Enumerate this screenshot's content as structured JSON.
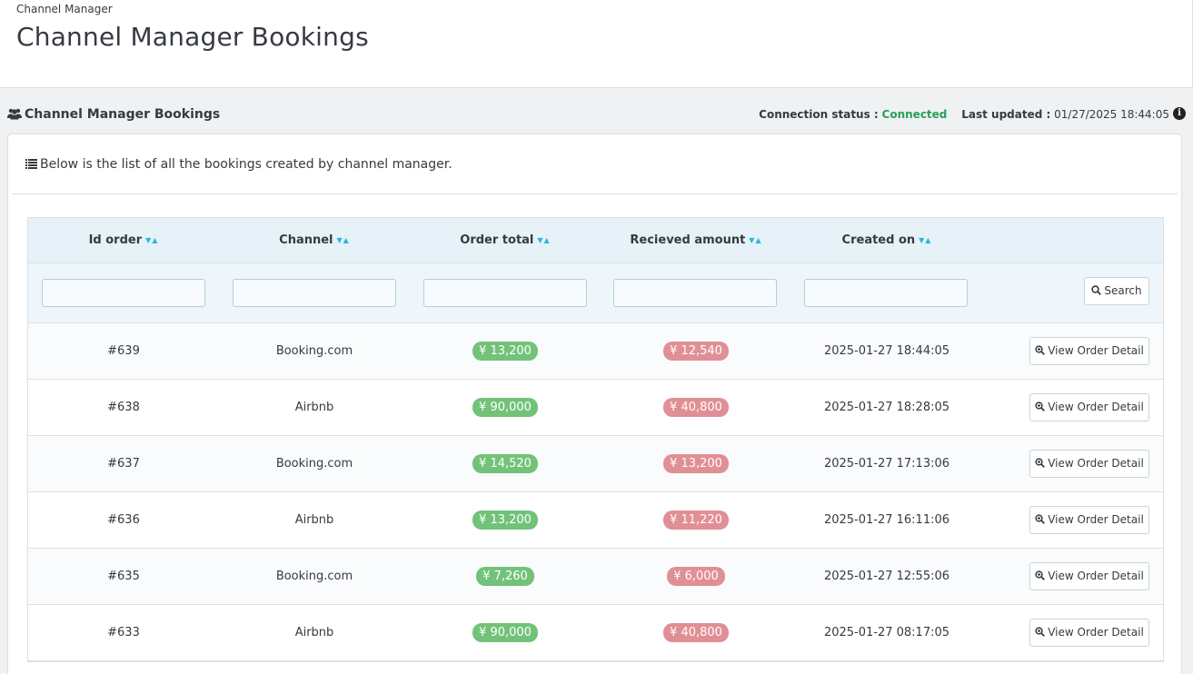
{
  "header": {
    "breadcrumb": "Channel Manager",
    "title": "Channel Manager Bookings"
  },
  "panel_heading": {
    "icon": "users-icon",
    "title": "Channel Manager Bookings",
    "connection_label": "Connection status :",
    "connection_value": "Connected",
    "last_updated_label": "Last updated :",
    "last_updated_value": "01/27/2025 18:44:05",
    "info_icon": "info-circle-icon"
  },
  "intro": {
    "icon": "list-icon",
    "text": "Below is the list of all the bookings created by channel manager."
  },
  "table": {
    "columns": [
      "Id order",
      "Channel",
      "Order total",
      "Recieved amount",
      "Created on"
    ],
    "search_label": "Search",
    "view_label": "View Order Detail",
    "rows": [
      {
        "id": "#639",
        "channel": "Booking.com",
        "total": "¥ 13,200",
        "received": "¥ 12,540",
        "created": "2025-01-27 18:44:05"
      },
      {
        "id": "#638",
        "channel": "Airbnb",
        "total": "¥ 90,000",
        "received": "¥ 40,800",
        "created": "2025-01-27 18:28:05"
      },
      {
        "id": "#637",
        "channel": "Booking.com",
        "total": "¥ 14,520",
        "received": "¥ 13,200",
        "created": "2025-01-27 17:13:06"
      },
      {
        "id": "#636",
        "channel": "Airbnb",
        "total": "¥ 13,200",
        "received": "¥ 11,220",
        "created": "2025-01-27 16:11:06"
      },
      {
        "id": "#635",
        "channel": "Booking.com",
        "total": "¥ 7,260",
        "received": "¥ 6,000",
        "created": "2025-01-27 12:55:06"
      },
      {
        "id": "#633",
        "channel": "Airbnb",
        "total": "¥ 90,000",
        "received": "¥ 40,800",
        "created": "2025-01-27 08:17:05"
      }
    ]
  },
  "colors": {
    "connected": "#27a05a",
    "total_badge": "#72c279",
    "received_badge": "#e08f95",
    "sort_arrow": "#25b9d7"
  }
}
